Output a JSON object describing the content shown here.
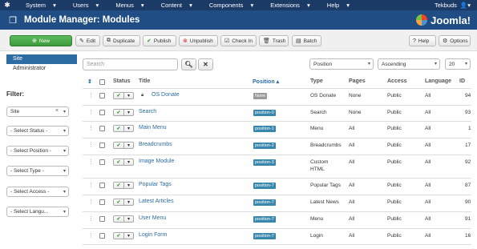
{
  "topbar": {
    "logo_icon": "joomla-icon",
    "menu": [
      "System",
      "Users",
      "Menus",
      "Content",
      "Components",
      "Extensions",
      "Help"
    ],
    "user": "Tekbuds",
    "user_icon": "user-icon"
  },
  "header": {
    "title": "Module Manager: Modules",
    "brand": "Joomla!",
    "brand_icon": "joomla-logo"
  },
  "toolbar": {
    "new": "New",
    "edit": "Edit",
    "duplicate": "Duplicate",
    "publish": "Publish",
    "unpublish": "Unpublish",
    "checkin": "Check In",
    "trash": "Trash",
    "batch": "Batch",
    "help": "Help",
    "options": "Options"
  },
  "sidebar": {
    "items": [
      "Site",
      "Administrator"
    ],
    "active": "Site"
  },
  "filter": {
    "label": "Filter:",
    "client": "Site",
    "status": "- Select Status -",
    "position": "- Select Position -",
    "type": "- Select Type -",
    "access": "- Select Access -",
    "language": "- Select Langu..."
  },
  "search": {
    "placeholder": "Search"
  },
  "list": {
    "ordering": "Position",
    "direction": "Ascending",
    "limit": "20"
  },
  "columns": {
    "status": "Status",
    "title": "Title",
    "position": "Position",
    "type": "Type",
    "pages": "Pages",
    "access": "Access",
    "language": "Language",
    "id": "ID"
  },
  "rows": [
    {
      "title": "OS Donate",
      "position": "None",
      "type": "OS Donate",
      "pages": "None",
      "access": "Public",
      "language": "All",
      "id": "94",
      "locked": true
    },
    {
      "title": "Search",
      "position": "position-0",
      "type": "Search",
      "pages": "None",
      "access": "Public",
      "language": "All",
      "id": "93"
    },
    {
      "title": "Main Menu",
      "position": "position-1",
      "type": "Menu",
      "pages": "All",
      "access": "Public",
      "language": "All",
      "id": "1"
    },
    {
      "title": "Breadcrumbs",
      "position": "position-2",
      "type": "Breadcrumbs",
      "pages": "All",
      "access": "Public",
      "language": "All",
      "id": "17"
    },
    {
      "title": "Image Module",
      "position": "position-3",
      "type": "Custom HTML",
      "type_line1": "Custom",
      "type_line2": "HTML",
      "pages": "All",
      "access": "Public",
      "language": "All",
      "id": "92"
    },
    {
      "title": "Popular Tags",
      "position": "position-7",
      "type": "Popular Tags",
      "pages": "All",
      "access": "Public",
      "language": "All",
      "id": "87"
    },
    {
      "title": "Latest Articles",
      "position": "position-7",
      "type": "Latest News",
      "pages": "All",
      "access": "Public",
      "language": "All",
      "id": "90"
    },
    {
      "title": "User Menu",
      "position": "position-7",
      "type": "Menu",
      "pages": "All",
      "access": "Public",
      "language": "All",
      "id": "91"
    },
    {
      "title": "Login Form",
      "position": "position-7",
      "type": "Login",
      "pages": "All",
      "access": "Public",
      "language": "All",
      "id": "16"
    }
  ]
}
